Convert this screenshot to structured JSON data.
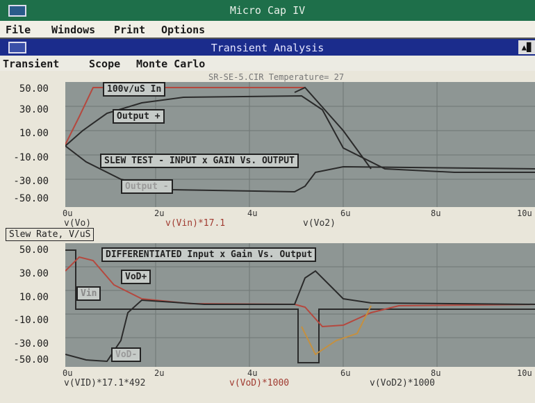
{
  "app": {
    "title": "Micro Cap IV"
  },
  "menu": {
    "file": "File",
    "windows": "Windows",
    "print": "Print",
    "options": "Options"
  },
  "window": {
    "title": "Transient Analysis",
    "max_glyph": "▲▉"
  },
  "submenu": {
    "transient": "Transient",
    "scope": "Scope",
    "montecarlo": "Monte Carlo"
  },
  "top": {
    "header": "SR-SE-5.CIR Temperature= 27",
    "y_ticks": [
      "50.00",
      "30.00",
      "10.00",
      "-10.00",
      "-30.00",
      "-50.00"
    ],
    "x_ticks": [
      "0u",
      "2u",
      "4u",
      "6u",
      "8u",
      "10u"
    ],
    "labels": {
      "in": "100v/uS In",
      "out_plus": "Output +",
      "title": "SLEW TEST - INPUT x GAIN  Vs. OUTPUT",
      "out_minus": "Output -"
    },
    "axis": {
      "v1": "v(Vo)",
      "v2": "v(Vin)*17.1",
      "v3": "v(Vo2)"
    }
  },
  "bottom": {
    "slew": "Slew Rate, V/uS",
    "y_ticks": [
      "50.00",
      "30.00",
      "10.00",
      "-10.00",
      "-30.00",
      "-50.00"
    ],
    "x_ticks": [
      "0u",
      "2u",
      "4u",
      "6u",
      "8u",
      "10u"
    ],
    "labels": {
      "title": "DIFFERENTIATED Input x Gain  Vs. Output",
      "vod_plus": "VoD+",
      "vin": "Vin",
      "vod_minus": "VoD-"
    },
    "axis": {
      "v1": "v(VID)*17.1*492",
      "v2": "v(VoD)*1000",
      "v3": "v(VoD2)*1000"
    }
  },
  "colors": {
    "plot_bg": "#8e9694",
    "title_green": "#1e6f4a",
    "title_blue": "#1b2c8c",
    "trace_red": "#b5483e",
    "trace_dark": "#2a2a2a"
  }
}
